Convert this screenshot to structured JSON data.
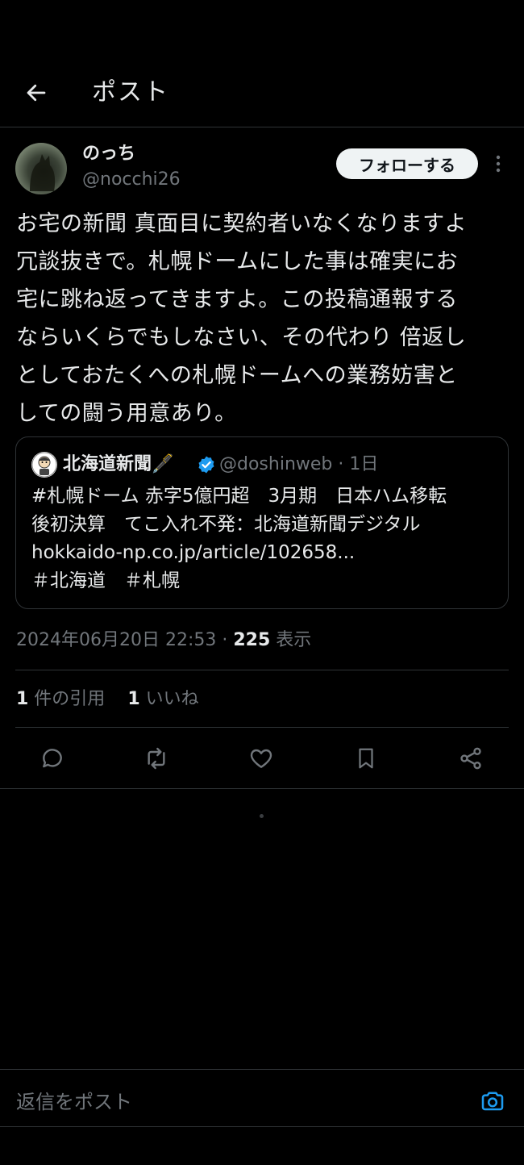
{
  "header": {
    "title": "ポスト"
  },
  "author": {
    "display_name": "のっち",
    "handle": "@nocchi26",
    "follow_label": "フォローする"
  },
  "post": {
    "text": "お宅の新聞 真面目に契約者いなくなりますよ\n冗談抜きで。札幌ドームにした事は確実にお\n宅に跳ね返ってきますよ。この投稿通報する\nならいくらでもしなさい、その代わり 倍返し\nとしておたくへの札幌ドームへの業務妨害と\nしての闘う用意あり。",
    "timestamp": "2024年06月20日 22:53 · ",
    "views_count": "225",
    "views_label": " 表示"
  },
  "quote": {
    "name": "北海道新聞🖋️",
    "handle": "@doshinweb · 1日",
    "text": "#札幌ドーム 赤字5億円超　3月期　日本ハム移転\n後初決算　てこ入れ不発：北海道新聞デジタル\nhokkaido-np.co.jp/article/102658...\n＃北海道　＃札幌"
  },
  "stats": {
    "quotes_count": "1",
    "quotes_label": " 件の引用",
    "likes_count": "1",
    "likes_label": " いいね"
  },
  "reply": {
    "placeholder": "返信をポスト"
  },
  "colors": {
    "background": "#000000",
    "text": "#e7e9ea",
    "muted": "#71767b",
    "border": "#2f3336",
    "verified": "#1d9bf0",
    "accent": "#1d9bf0"
  },
  "icons": {
    "back": "arrow-left-icon",
    "more": "vertical-dots-icon",
    "verified": "verified-badge-icon",
    "reply": "comment-icon",
    "repost": "repost-icon",
    "like": "heart-icon",
    "bookmark": "bookmark-icon",
    "share": "share-icon",
    "camera": "camera-icon"
  }
}
